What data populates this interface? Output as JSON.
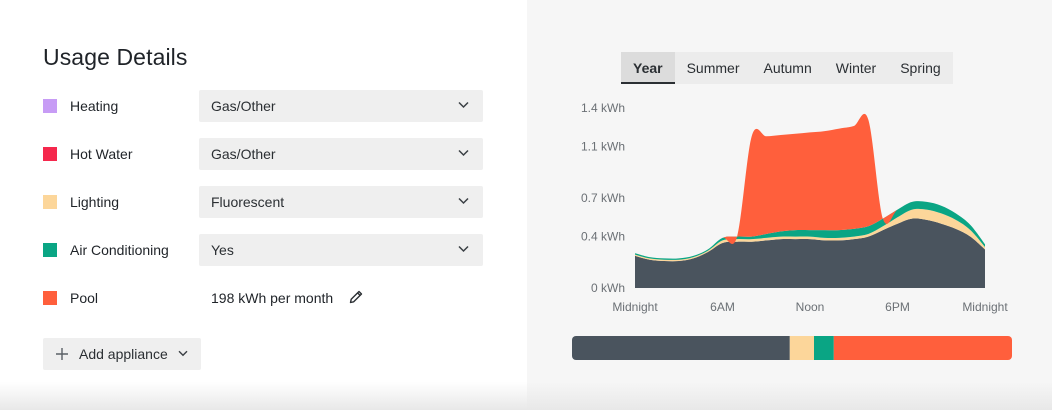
{
  "usage": {
    "title": "Usage Details",
    "appliances": [
      {
        "label": "Heating",
        "color": "#c79cf5",
        "selected": "Gas/Other"
      },
      {
        "label": "Hot Water",
        "color": "#f5284d",
        "selected": "Gas/Other"
      },
      {
        "label": "Lighting",
        "color": "#fcd69a",
        "selected": "Fluorescent"
      },
      {
        "label": "Air Conditioning",
        "color": "#0aa584",
        "selected": "Yes"
      }
    ],
    "pool": {
      "label": "Pool",
      "color": "#ff5f3c",
      "value": "198 kWh per month"
    },
    "add_button": "Add appliance"
  },
  "icons": {
    "dropdown": "chevron-down-icon",
    "edit": "pencil-icon",
    "add": "plus-icon"
  },
  "season_tabs": {
    "active": "Year",
    "items": [
      "Year",
      "Summer",
      "Autumn",
      "Winter",
      "Spring"
    ]
  },
  "chart_data": {
    "type": "area",
    "stacked": true,
    "x": [
      0,
      1,
      2,
      3,
      4,
      5,
      6,
      7,
      8,
      9,
      10,
      11,
      12,
      13,
      14,
      15,
      16,
      17,
      18,
      19,
      20,
      21,
      22,
      23,
      24
    ],
    "x_ticks": [
      {
        "value": 0,
        "label": "Midnight"
      },
      {
        "value": 6,
        "label": "6AM"
      },
      {
        "value": 12,
        "label": "Noon"
      },
      {
        "value": 18,
        "label": "6PM"
      },
      {
        "value": 24,
        "label": "Midnight"
      }
    ],
    "y_ticks": [
      {
        "value": 0,
        "label": "0 kWh"
      },
      {
        "value": 0.4,
        "label": "0.4 kWh"
      },
      {
        "value": 0.7,
        "label": "0.7 kWh"
      },
      {
        "value": 1.1,
        "label": "1.1 kWh"
      },
      {
        "value": 1.4,
        "label": "1.4 kWh"
      }
    ],
    "ylim": [
      0,
      1.4
    ],
    "grid": false,
    "series": [
      {
        "key": "base",
        "color": "#4a545e",
        "values": [
          0.25,
          0.22,
          0.21,
          0.21,
          0.23,
          0.28,
          0.35,
          0.36,
          0.36,
          0.37,
          0.38,
          0.38,
          0.38,
          0.37,
          0.37,
          0.38,
          0.4,
          0.45,
          0.5,
          0.54,
          0.53,
          0.5,
          0.46,
          0.4,
          0.3
        ]
      },
      {
        "key": "lighting",
        "color": "#fcd69a",
        "values": [
          0.01,
          0.01,
          0.01,
          0.01,
          0.01,
          0.01,
          0.02,
          0.02,
          0.02,
          0.02,
          0.02,
          0.02,
          0.02,
          0.02,
          0.02,
          0.02,
          0.02,
          0.03,
          0.05,
          0.07,
          0.08,
          0.08,
          0.07,
          0.05,
          0.02
        ]
      },
      {
        "key": "air_conditioning",
        "color": "#0aa584",
        "values": [
          0.01,
          0.01,
          0.01,
          0.01,
          0.01,
          0.01,
          0.02,
          0.02,
          0.02,
          0.03,
          0.04,
          0.05,
          0.05,
          0.06,
          0.06,
          0.06,
          0.06,
          0.06,
          0.06,
          0.06,
          0.06,
          0.06,
          0.05,
          0.04,
          0.02
        ]
      },
      {
        "key": "pool",
        "color": "#ff5f3c",
        "values": [
          0,
          0,
          0,
          0,
          0,
          0,
          0,
          0,
          0.78,
          0.76,
          0.75,
          0.75,
          0.76,
          0.77,
          0.79,
          0.8,
          0.83,
          0,
          0,
          0,
          0,
          0,
          0,
          0,
          0
        ]
      }
    ]
  },
  "mix_bar": {
    "segments": [
      {
        "key": "base",
        "color": "#4a545e",
        "share": 0.495
      },
      {
        "key": "lighting",
        "color": "#fcd69a",
        "share": 0.055
      },
      {
        "key": "air_conditioning",
        "color": "#0aa584",
        "share": 0.045
      },
      {
        "key": "pool",
        "color": "#ff5f3c",
        "share": 0.405
      }
    ]
  }
}
